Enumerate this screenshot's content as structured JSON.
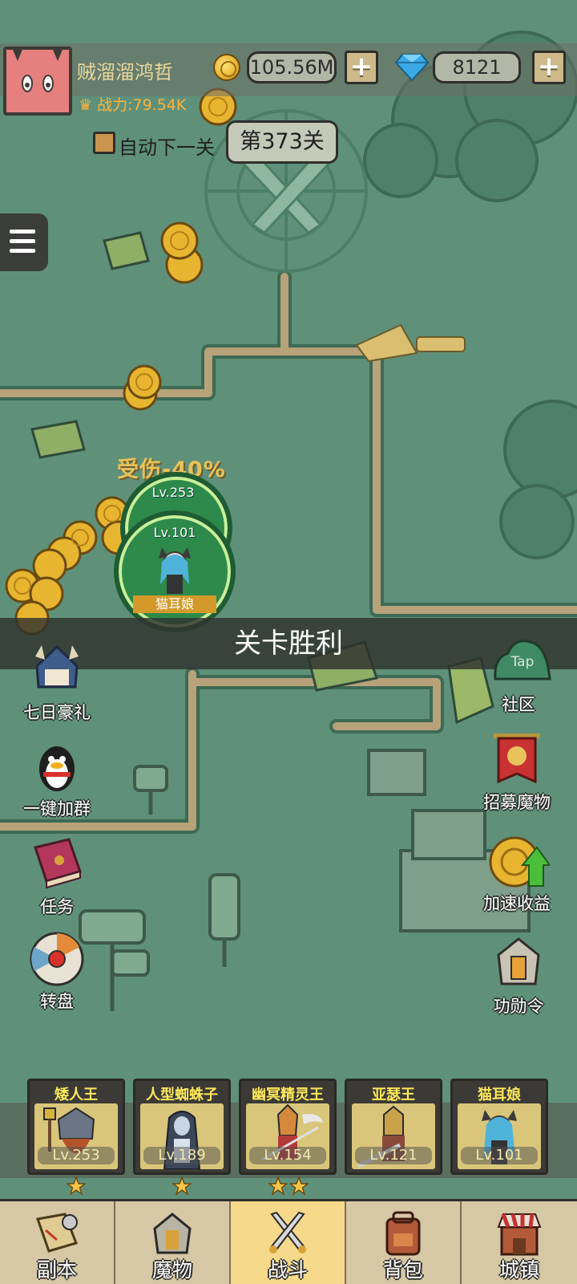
{
  "player": {
    "name": "贼溜溜鸿哲",
    "power": "战力:79.54K"
  },
  "currency": {
    "gold": "105.56M",
    "gems": "8121",
    "add_gold_label": "+",
    "add_gems_label": "+"
  },
  "stage": {
    "auto_next_label": "自动下一关",
    "current": "第373关"
  },
  "battle": {
    "damage_taken": "受伤-40%",
    "enemy_level": "Lv.253",
    "ally_level": "Lv.101",
    "ally_name": "猫耳娘",
    "result_banner": "关卡胜利"
  },
  "left_features": [
    {
      "label": "七日豪礼",
      "icon": "warrior-helmet-icon"
    },
    {
      "label": "一键加群",
      "icon": "penguin-icon"
    },
    {
      "label": "任务",
      "icon": "quest-book-icon"
    },
    {
      "label": "转盘",
      "icon": "wheel-icon"
    }
  ],
  "right_features": [
    {
      "label": "社区",
      "icon": "tap-slime-icon",
      "tap_text": "Tap"
    },
    {
      "label": "招募魔物",
      "icon": "recruit-banner-icon"
    },
    {
      "label": "加速收益",
      "icon": "coin-boost-icon"
    },
    {
      "label": "功勋令",
      "icon": "medal-helmet-icon"
    }
  ],
  "heroes": [
    {
      "name": "矮人王",
      "level": "Lv.253",
      "stars": 1
    },
    {
      "name": "人型蜘蛛子",
      "level": "Lv.189",
      "stars": 1
    },
    {
      "name": "幽冥精灵王",
      "level": "Lv.154",
      "stars": 2
    },
    {
      "name": "亚瑟王",
      "level": "Lv.121",
      "stars": 0
    },
    {
      "name": "猫耳娘",
      "level": "Lv.101",
      "stars": 0
    }
  ],
  "bottom_nav": [
    {
      "label": "副本",
      "icon": "map-scroll-icon",
      "active": false
    },
    {
      "label": "魔物",
      "icon": "monster-helmet-icon",
      "active": false
    },
    {
      "label": "战斗",
      "icon": "crossed-swords-icon",
      "active": true
    },
    {
      "label": "背包",
      "icon": "backpack-icon",
      "active": false
    },
    {
      "label": "城镇",
      "icon": "town-shop-icon",
      "active": false
    }
  ],
  "colors": {
    "map_green": "#5f917a",
    "path_tan": "#b8a27a",
    "gold": "#e8b530",
    "gem": "#3aa9e6",
    "active_tab": "#f6d98a",
    "hero_name": "#ffe95a"
  }
}
